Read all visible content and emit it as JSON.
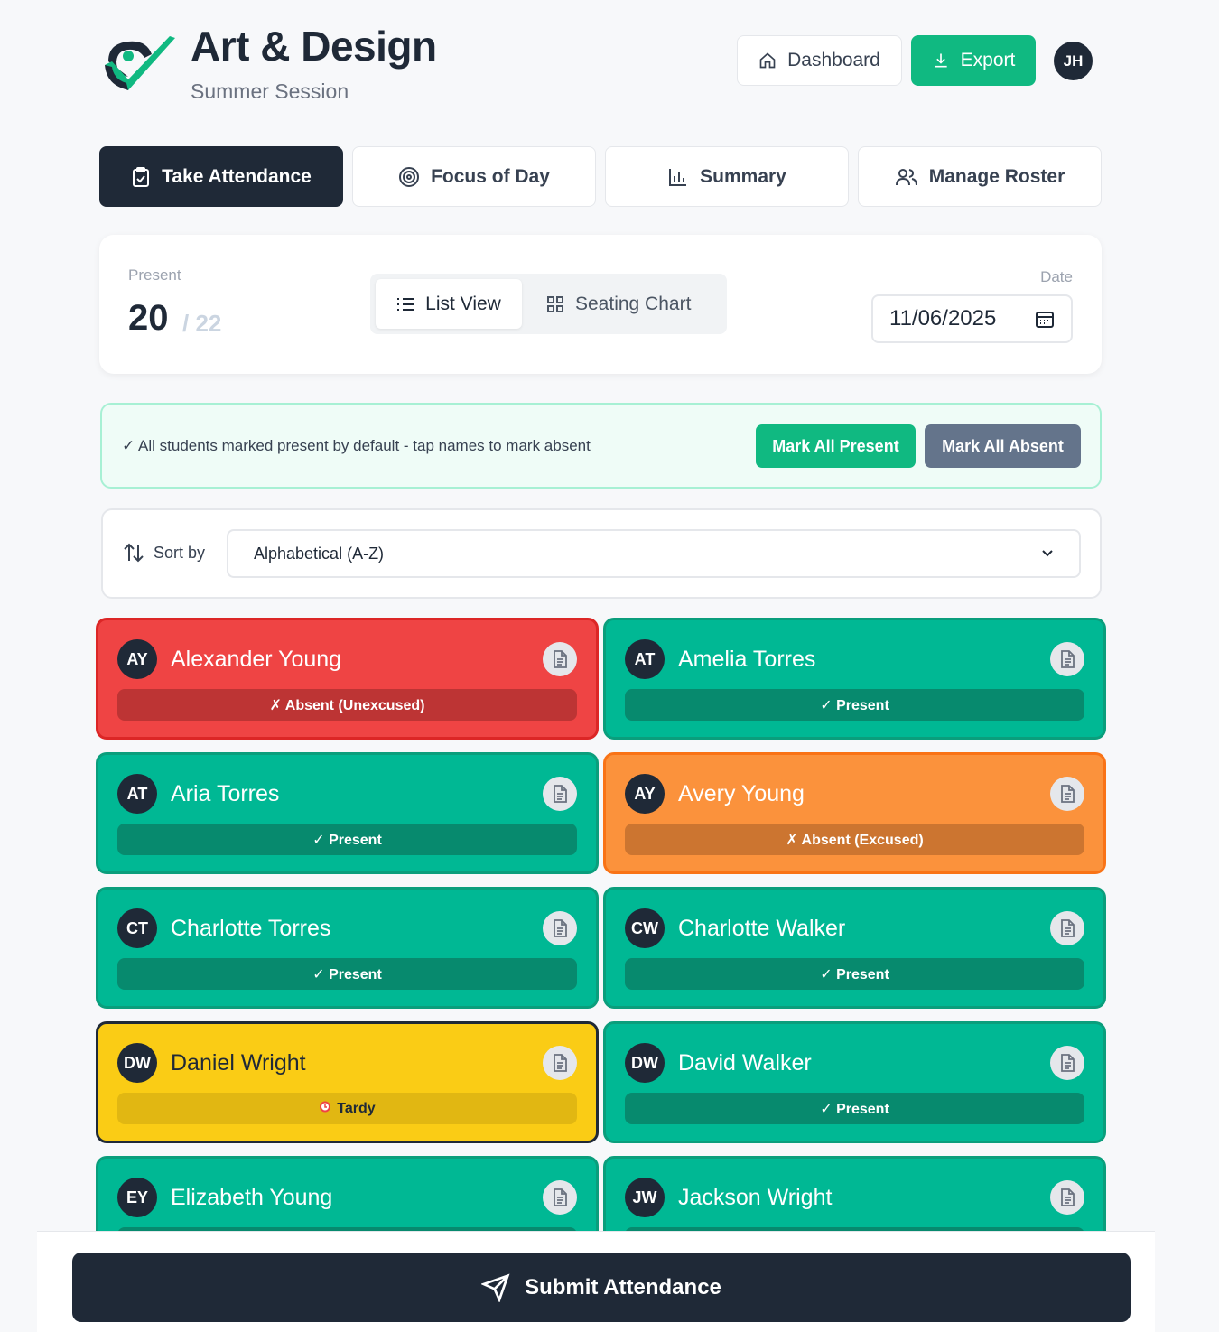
{
  "header": {
    "title": "Art & Design",
    "subtitle": "Summer Session",
    "dashboard_label": "Dashboard",
    "export_label": "Export",
    "user_initials": "JH"
  },
  "tabs": [
    {
      "label": "Take Attendance",
      "icon": "clipboard-check-icon",
      "active": true
    },
    {
      "label": "Focus of Day",
      "icon": "target-icon",
      "active": false
    },
    {
      "label": "Summary",
      "icon": "bar-chart-icon",
      "active": false
    },
    {
      "label": "Manage Roster",
      "icon": "users-icon",
      "active": false
    }
  ],
  "stats": {
    "present_label": "Present",
    "present_count": "20",
    "present_total": "/ 22",
    "date_label": "Date",
    "date_value": "11/06/2025"
  },
  "view_toggle": {
    "list_label": "List View",
    "seating_label": "Seating Chart",
    "selected": "List View"
  },
  "banner": {
    "text": "✓ All students marked present by default - tap names to mark absent",
    "mark_all_present": "Mark All Present",
    "mark_all_absent": "Mark All Absent"
  },
  "sort": {
    "label": "Sort by",
    "selected": "Alphabetical (A-Z)"
  },
  "colors": {
    "present": "#00b894",
    "absent_unexcused": "#ef4444",
    "absent_excused": "#fb923c",
    "tardy": "#facc15",
    "dark": "#1f2937",
    "accent": "#10b981"
  },
  "students": [
    {
      "initials": "AY",
      "name": "Alexander Young",
      "status": "✗ Absent (Unexcused)",
      "kind": "red"
    },
    {
      "initials": "AT",
      "name": "Amelia Torres",
      "status": "✓ Present",
      "kind": "green"
    },
    {
      "initials": "AT",
      "name": "Aria Torres",
      "status": "✓ Present",
      "kind": "green"
    },
    {
      "initials": "AY",
      "name": "Avery Young",
      "status": "✗ Absent (Excused)",
      "kind": "orange"
    },
    {
      "initials": "CT",
      "name": "Charlotte Torres",
      "status": "✓ Present",
      "kind": "green"
    },
    {
      "initials": "CW",
      "name": "Charlotte Walker",
      "status": "✓ Present",
      "kind": "green"
    },
    {
      "initials": "DW",
      "name": "Daniel Wright",
      "status": "Tardy",
      "kind": "yellow"
    },
    {
      "initials": "DW",
      "name": "David Walker",
      "status": "✓ Present",
      "kind": "green"
    },
    {
      "initials": "EY",
      "name": "Elizabeth Young",
      "status": "",
      "kind": "green"
    },
    {
      "initials": "JW",
      "name": "Jackson Wright",
      "status": "",
      "kind": "green"
    }
  ],
  "submit_label": "Submit Attendance"
}
